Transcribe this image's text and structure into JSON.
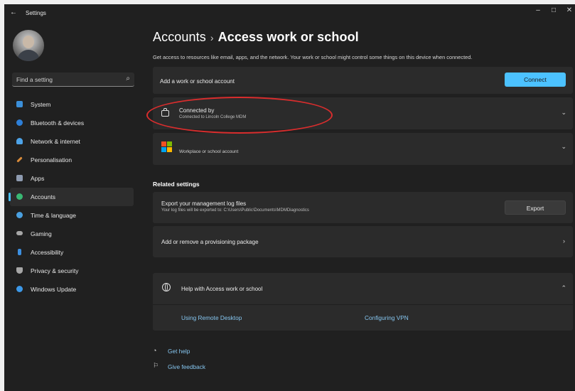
{
  "window": {
    "app_title": "Settings",
    "back_glyph": "←",
    "minimize_glyph": "–",
    "maximize_glyph": "□",
    "close_glyph": "✕"
  },
  "sidebar": {
    "search_placeholder": "Find a setting",
    "items": [
      {
        "label": "System",
        "icon": "system-icon",
        "color": "#3b8fd9"
      },
      {
        "label": "Bluetooth & devices",
        "icon": "bluetooth-icon",
        "color": "#2d7fd8"
      },
      {
        "label": "Network & internet",
        "icon": "network-icon",
        "color": "#4da3e8"
      },
      {
        "label": "Personalisation",
        "icon": "brush-icon",
        "color": "#d98b3a"
      },
      {
        "label": "Apps",
        "icon": "apps-icon",
        "color": "#8e9bb0"
      },
      {
        "label": "Accounts",
        "icon": "accounts-icon",
        "color": "#39b873",
        "active": true
      },
      {
        "label": "Time & language",
        "icon": "globe-clock-icon",
        "color": "#4aa0e0"
      },
      {
        "label": "Gaming",
        "icon": "gamepad-icon",
        "color": "#a6a6a6"
      },
      {
        "label": "Accessibility",
        "icon": "accessibility-icon",
        "color": "#3c8fe0"
      },
      {
        "label": "Privacy & security",
        "icon": "shield-icon",
        "color": "#a6a6a6"
      },
      {
        "label": "Windows Update",
        "icon": "update-icon",
        "color": "#3c98e8"
      }
    ]
  },
  "header": {
    "parent": "Accounts",
    "separator": "›",
    "current": "Access work or school",
    "description": "Get access to resources like email, apps, and the network. Your work or school might control some things on this device when connected."
  },
  "add_account": {
    "label": "Add a work or school account",
    "button": "Connect"
  },
  "connected": {
    "title": "Connected by",
    "subtitle": "Connected to Lincoln College MDM"
  },
  "workplace": {
    "label": "Workplace or school account"
  },
  "related": {
    "title": "Related settings",
    "export_title": "Export your management log files",
    "export_sub": "Your log files will be exported to: C:\\Users\\Public\\Documents\\MDMDiagnostics",
    "export_button": "Export",
    "provisioning": "Add or remove a provisioning package"
  },
  "help": {
    "title": "Help with Access work or school",
    "links": [
      "Using Remote Desktop",
      "Configuring VPN"
    ]
  },
  "footer": {
    "get_help": "Get help",
    "feedback": "Give feedback"
  },
  "colors": {
    "accent": "#4cc2ff",
    "annotation": "#d92d2d"
  }
}
